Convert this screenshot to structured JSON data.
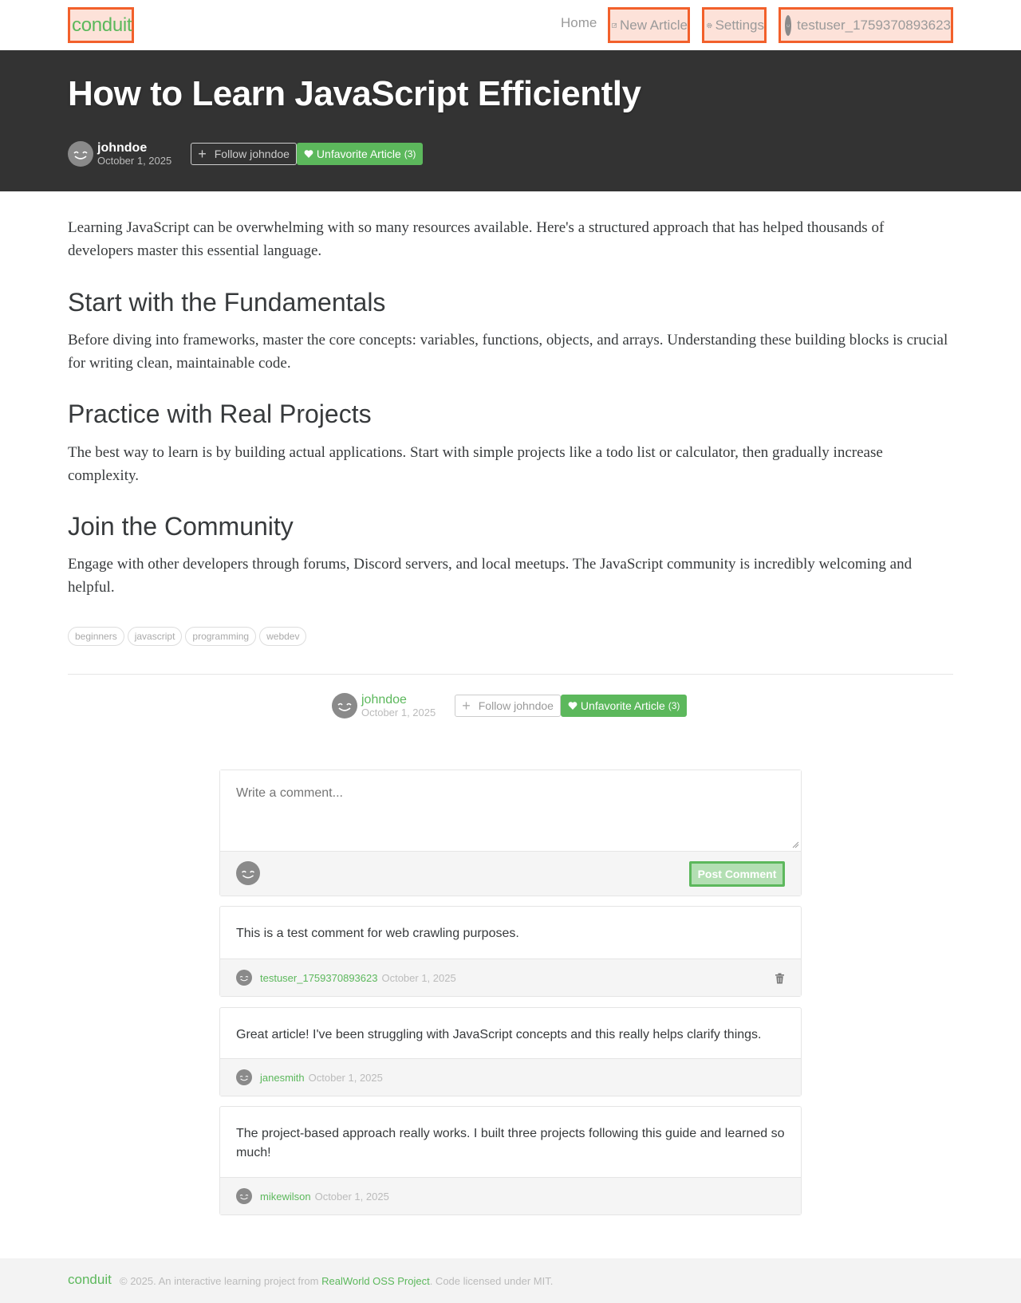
{
  "nav": {
    "brand": "conduit",
    "home": "Home",
    "new_article": "New Article",
    "settings": "Settings",
    "username": "testuser_1759370893623"
  },
  "article": {
    "title": "How to Learn JavaScript Efficiently",
    "author": "johndoe",
    "date": "October 1, 2025",
    "follow_label": "Follow johndoe",
    "favorite_label": "Unfavorite Article",
    "favorite_count": "(3)",
    "paragraphs": {
      "intro": "Learning JavaScript can be overwhelming with so many resources available. Here's a structured approach that has helped thousands of developers master this essential language.",
      "fundamentals": "Before diving into frameworks, master the core concepts: variables, functions, objects, and arrays. Understanding these building blocks is crucial for writing clean, maintainable code.",
      "projects": "The best way to learn is by building actual applications. Start with simple projects like a todo list or calculator, then gradually increase complexity.",
      "community": "Engage with other developers through forums, Discord servers, and local meetups. The JavaScript community is incredibly welcoming and helpful."
    },
    "headings": {
      "fundamentals": "Start with the Fundamentals",
      "projects": "Practice with Real Projects",
      "community": "Join the Community"
    },
    "tags": [
      "beginners",
      "javascript",
      "programming",
      "webdev"
    ]
  },
  "comment_form": {
    "placeholder": "Write a comment...",
    "post_label": "Post Comment"
  },
  "comments": [
    {
      "text": "This is a test comment for web crawling purposes.",
      "author": "testuser_1759370893623",
      "date": "October 1, 2025",
      "deletable": true
    },
    {
      "text": "Great article! I've been struggling with JavaScript concepts and this really helps clarify things.",
      "author": "janesmith",
      "date": "October 1, 2025",
      "deletable": false
    },
    {
      "text": "The project-based approach really works. I built three projects following this guide and learned so much!",
      "author": "mikewilson",
      "date": "October 1, 2025",
      "deletable": false
    }
  ],
  "footer": {
    "brand": "conduit",
    "text_before": "© 2025. An interactive learning project from ",
    "link": "RealWorld OSS Project",
    "text_after": ". Code licensed under MIT."
  },
  "colors": {
    "accent": "#5cb85c",
    "banner": "#333333",
    "highlight_border": "#f2602b"
  },
  "icons": {
    "new_article": "edit-icon",
    "settings": "gear-icon",
    "avatar": "smiley-avatar-icon",
    "follow": "plus-icon",
    "favorite": "heart-icon",
    "delete": "trash-icon"
  }
}
